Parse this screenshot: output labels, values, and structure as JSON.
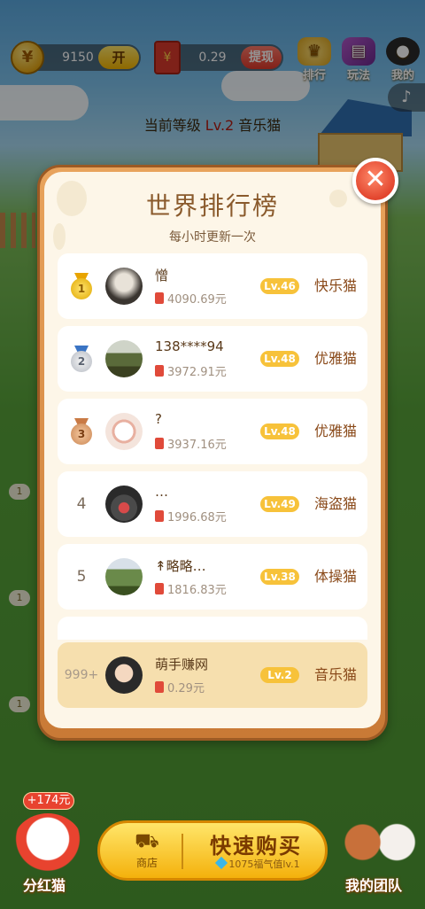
{
  "topbar": {
    "coin_icon_glyph": "¥",
    "coins": "9150",
    "open_label": "开",
    "cash_icon_glyph": "¥",
    "cash": "0.29",
    "withdraw_label": "提现",
    "rank_label": "排行",
    "guide_label": "玩法",
    "mine_label": "我的",
    "music_icon": "music-note-icon"
  },
  "level": {
    "prefix": "当前等级",
    "level": "Lv.2",
    "cat": "音乐猫"
  },
  "side_badges": [
    "1",
    "1",
    "1"
  ],
  "leaderboard": {
    "title": "世界排行榜",
    "subtitle": "每小时更新一次",
    "entries": [
      {
        "rank": "1",
        "name": "憎",
        "money": "4090.69元",
        "level": "Lv.46",
        "cat": "快乐猫"
      },
      {
        "rank": "2",
        "name": "138****94",
        "money": "3972.91元",
        "level": "Lv.48",
        "cat": "优雅猫"
      },
      {
        "rank": "3",
        "name": "?",
        "money": "3937.16元",
        "level": "Lv.48",
        "cat": "优雅猫"
      },
      {
        "rank": "4",
        "name": "…",
        "money": "1996.68元",
        "level": "Lv.49",
        "cat": "海盗猫"
      },
      {
        "rank": "5",
        "name": "↟略略…",
        "money": "1816.83元",
        "level": "Lv.38",
        "cat": "体操猫"
      }
    ],
    "me": {
      "rank": "999+",
      "name": "萌手赚网",
      "money": "0.29元",
      "level": "Lv.2",
      "cat": "音乐猫"
    }
  },
  "bottom": {
    "bonus": "+174元",
    "dividend_label": "分红猫",
    "shop_label": "商店",
    "buy_title": "快速购买",
    "buy_sub": "1075福气值lv.1",
    "team_label": "我的团队"
  },
  "colors": {
    "accent": "#f7c23a",
    "frame": "#c97a36",
    "panel": "#fdf6e8"
  }
}
